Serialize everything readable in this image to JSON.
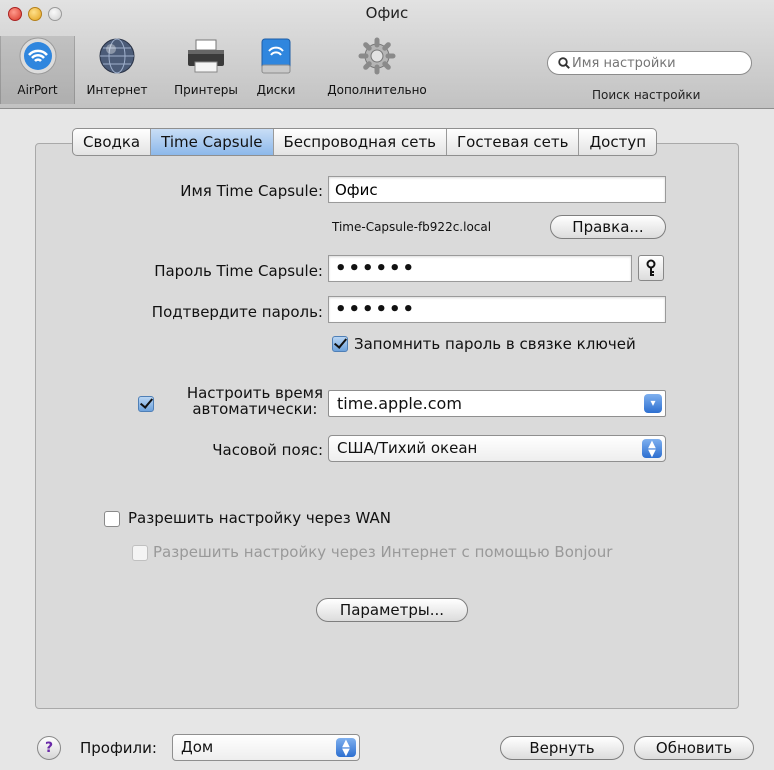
{
  "window": {
    "title": "Офис"
  },
  "toolbar": {
    "items": [
      {
        "label": "AirPort",
        "icon": "airport-icon"
      },
      {
        "label": "Интернет",
        "icon": "globe-icon"
      },
      {
        "label": "Принтеры",
        "icon": "printer-icon"
      },
      {
        "label": "Диски",
        "icon": "disk-icon"
      },
      {
        "label": "Дополнительно",
        "icon": "gear-icon"
      }
    ],
    "selected": "AirPort",
    "search": {
      "placeholder": "Имя настройки",
      "label": "Поиск настройки"
    }
  },
  "tabs": [
    {
      "label": "Сводка"
    },
    {
      "label": "Time Capsule"
    },
    {
      "label": "Беспроводная сеть"
    },
    {
      "label": "Гостевая сеть"
    },
    {
      "label": "Доступ"
    }
  ],
  "active_tab": "Time Capsule",
  "form": {
    "name_label": "Имя Time Capsule:",
    "name_value": "Офис",
    "hostname": "Time-Capsule-fb922c.local",
    "edit_button": "Правка...",
    "password_label": "Пароль Time Capsule:",
    "password_value": "••••••",
    "confirm_label": "Подтвердите пароль:",
    "confirm_value": "••••••",
    "remember_label": "Запомнить пароль в связке ключей",
    "remember_checked": true,
    "auto_time_label_line1": "Настроить время",
    "auto_time_label_line2": "автоматически:",
    "auto_time_checked": true,
    "time_server": "time.apple.com",
    "timezone_label": "Часовой пояс:",
    "timezone_value": "США/Тихий океан",
    "wan_label": "Разрешить настройку через WAN",
    "wan_checked": false,
    "bonjour_label": "Разрешить настройку через Интернет с помощью Bonjour",
    "bonjour_checked": false,
    "params_button": "Параметры..."
  },
  "footer": {
    "help": "?",
    "profiles_label": "Профили:",
    "profile_value": "Дом",
    "revert_button": "Вернуть",
    "update_button": "Обновить"
  },
  "colors": {
    "accent_blue": "#3b7fd8",
    "tab_active": "#9cc2ee",
    "close": "#d8382a",
    "minimize": "#e2a21e"
  }
}
